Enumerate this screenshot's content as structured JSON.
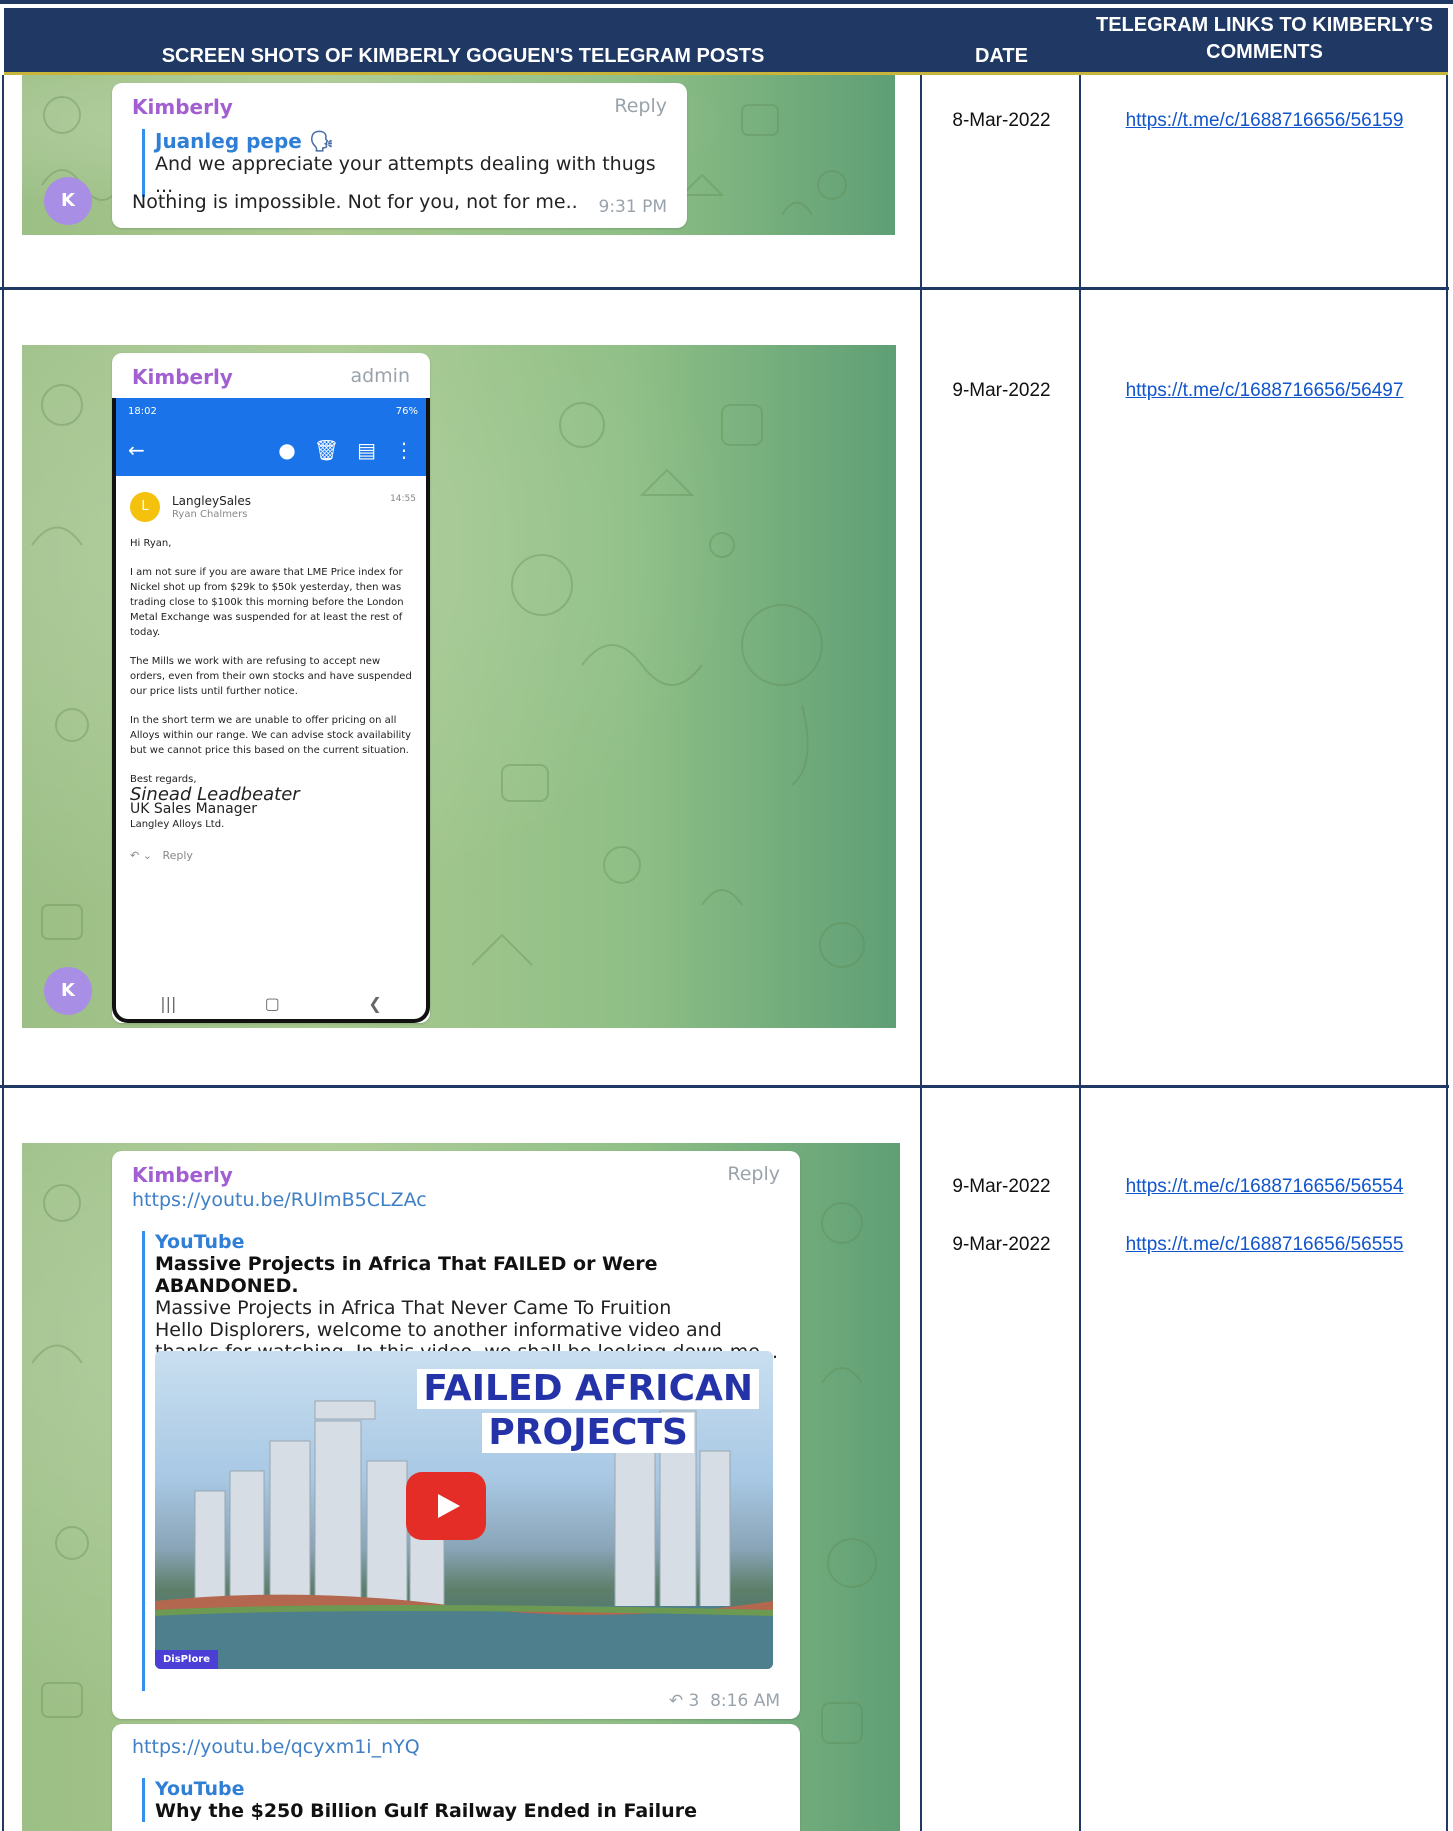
{
  "header": {
    "screenshots": "SCREEN SHOTS OF KIMBERLY GOGUEN'S TELEGRAM POSTS",
    "date": "DATE",
    "links_line1": "TELEGRAM LINKS TO KIMBERLY'S",
    "links_line2": "COMMENTS"
  },
  "rows": [
    {
      "dates": [
        "8-Mar-2022"
      ],
      "links": [
        "https://t.me/c/1688716656/56159"
      ],
      "post": {
        "sender": "Kimberly",
        "action": "Reply",
        "quote_name": "Juanleg pepe",
        "quote_text": "And we appreciate your attempts dealing with thugs ...",
        "message": "Nothing is impossible. Not for you, not for me..",
        "time": "9:31 PM",
        "avatar": "K"
      }
    },
    {
      "dates": [
        "9-Mar-2022"
      ],
      "links": [
        "https://t.me/c/1688716656/56497"
      ],
      "post": {
        "sender": "Kimberly",
        "role": "admin",
        "avatar": "K",
        "phone": {
          "clock": "18:02",
          "battery": "76%",
          "mail_from": "LangleySales",
          "mail_to": "Ryan Chalmers",
          "mail_time": "14:55",
          "avatar_letter": "L",
          "greeting": "Hi Ryan,",
          "para1": "I am not sure if you are aware that LME Price index for Nickel shot up from $29k to $50k yesterday, then was trading close to $100k this morning before the London Metal Exchange was suspended for at least the rest of today.",
          "para2": "The Mills we work with are refusing to accept new orders, even from their own stocks and have suspended our price lists until further notice.",
          "para3": "In the short term we are unable to offer pricing on all Alloys within our range. We can advise stock availability but we cannot price this based on the current situation.",
          "closing": "Best regards,",
          "sig_name": "Sinead Leadbeater",
          "sig_role": "UK Sales Manager",
          "sig_company": "Langley Alloys Ltd.",
          "reply": "Reply"
        }
      }
    },
    {
      "dates": [
        "9-Mar-2022",
        "9-Mar-2022"
      ],
      "links": [
        "https://t.me/c/1688716656/56554",
        "https://t.me/c/1688716656/56555"
      ],
      "post": {
        "sender": "Kimberly",
        "action": "Reply",
        "link1": "https://youtu.be/RUlmB5CLZAc",
        "source": "YouTube",
        "title1": "Massive Projects in Africa That FAILED or Were ABANDONED.",
        "desc1_line1": "Massive Projects in Africa That Never Came To Fruition",
        "desc1_line2": "Hello Displorers, welcome to another informative video and",
        "desc1_line3": "thanks for watching. In this video, we shall be looking down me...",
        "thumb_line1": "FAILED AFRICAN",
        "thumb_line2": "PROJECTS",
        "thumb_brand": "DisPlore",
        "forwards": "3",
        "time": "8:16 AM",
        "link2": "https://youtu.be/qcyxm1i_nYQ",
        "source2": "YouTube",
        "title2": "Why the $250 Billion Gulf Railway Ended in Failure"
      }
    }
  ]
}
